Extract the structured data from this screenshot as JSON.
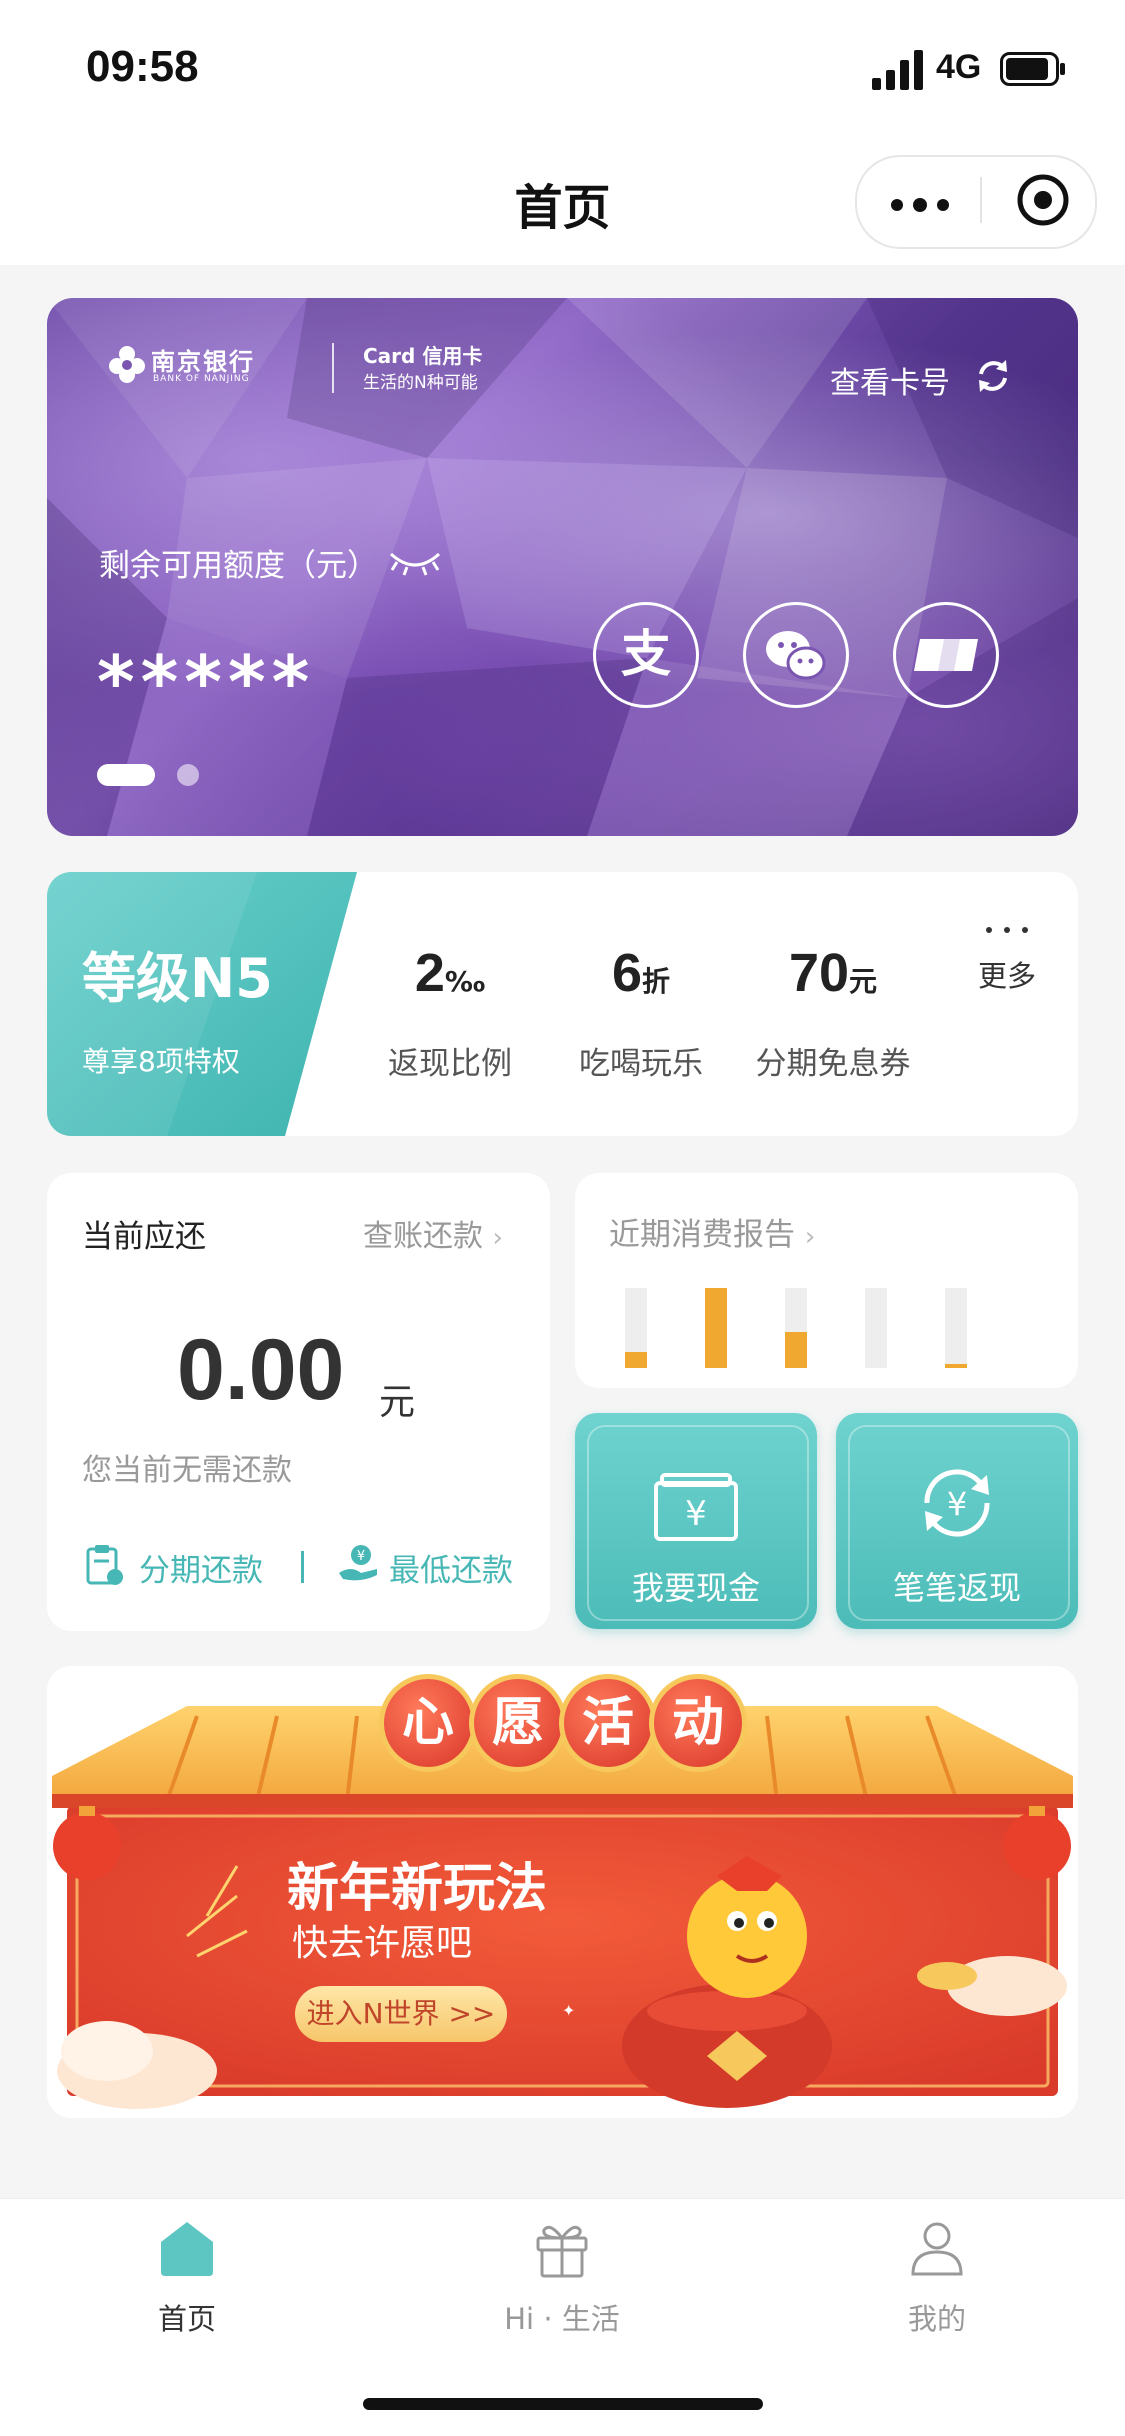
{
  "status": {
    "time": "09:58",
    "network": "4G"
  },
  "nav": {
    "title": "首页"
  },
  "card": {
    "bank_name": "南京银行",
    "bank_en": "BANK OF NANJING",
    "brand": "Card 信用卡",
    "brand_sub": "生活的N种可能",
    "view_card": "查看卡号",
    "available_label": "剩余可用额度（元）",
    "available_value": "*****"
  },
  "level": {
    "title": "等级N5",
    "subtitle": "尊享8项特权",
    "perks": [
      {
        "value": "2",
        "unit": "‰",
        "label": "返现比例"
      },
      {
        "value": "6",
        "unit": "折",
        "label": "吃喝玩乐"
      },
      {
        "value": "70",
        "unit": "元",
        "label": "分期免息券"
      }
    ],
    "more_label": "更多"
  },
  "repay": {
    "title": "当前应还",
    "link": "查账还款",
    "amount": "0.00",
    "unit": "元",
    "hint": "您当前无需还款",
    "installment": "分期还款",
    "minimum": "最低还款"
  },
  "report": {
    "title": "近期消费报告",
    "bar_levels": [
      0.2,
      1.0,
      0.45,
      0.0,
      0.05
    ]
  },
  "actions": [
    {
      "label": "我要现金"
    },
    {
      "label": "笔笔返现"
    }
  ],
  "banner": {
    "chars": [
      "心",
      "愿",
      "活",
      "动"
    ],
    "title": "新年新玩法",
    "subtitle": "快去许愿吧",
    "button": "进入N世界 >>"
  },
  "tabs": [
    {
      "label": "首页",
      "active": true
    },
    {
      "label": "Hi · 生活",
      "active": false
    },
    {
      "label": "我的",
      "active": false
    }
  ],
  "colors": {
    "accent": "#46b7b4",
    "report_bar": "#f0a830"
  }
}
